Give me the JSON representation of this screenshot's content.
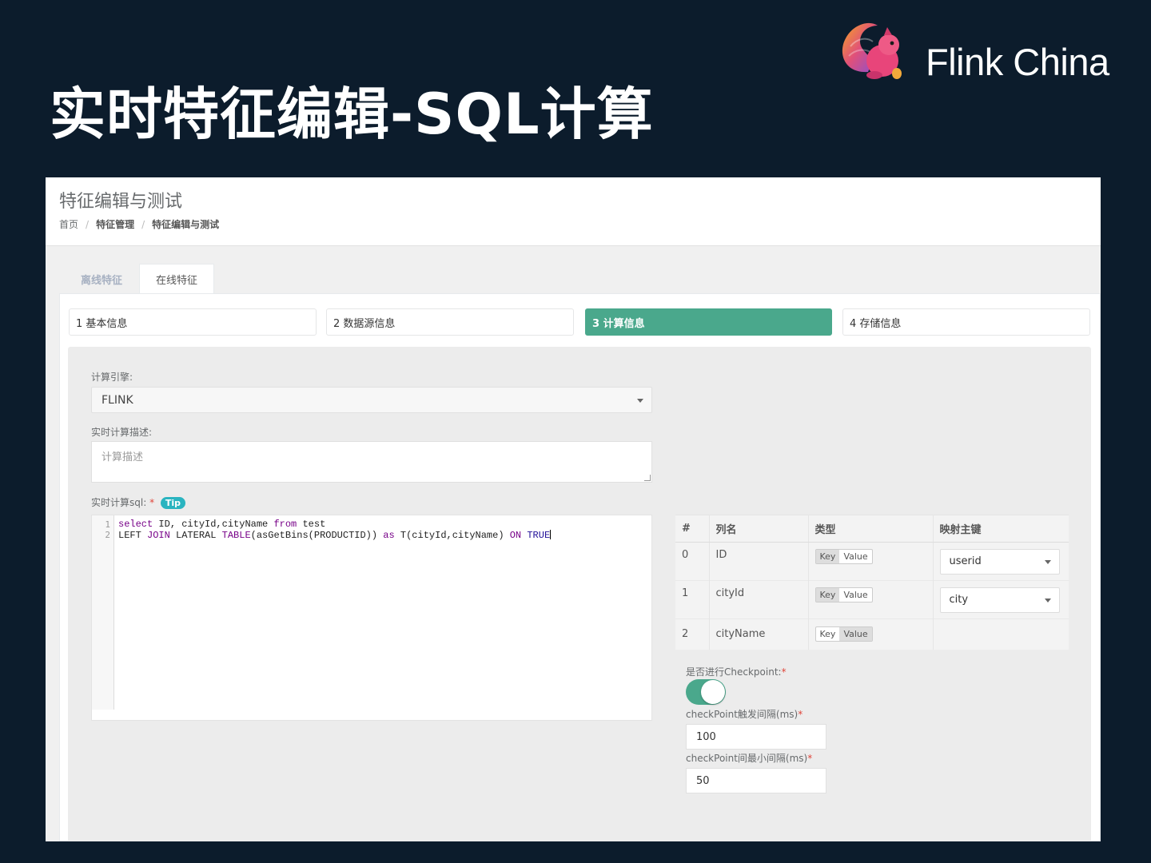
{
  "slide": {
    "title": "实时特征编辑-SQL计算",
    "logo_text": "Flink China"
  },
  "page": {
    "title": "特征编辑与测试",
    "breadcrumb": [
      "首页",
      "特征管理",
      "特征编辑与测试"
    ]
  },
  "tabs": [
    {
      "label": "离线特征",
      "active": false
    },
    {
      "label": "在线特征",
      "active": true
    }
  ],
  "steps": [
    {
      "label": "1 基本信息"
    },
    {
      "label": "2 数据源信息"
    },
    {
      "label": "3 计算信息",
      "active": true
    },
    {
      "label": "4 存储信息"
    }
  ],
  "form": {
    "engine_label": "计算引擎:",
    "engine_value": "FLINK",
    "desc_label": "实时计算描述:",
    "desc_placeholder": "计算描述",
    "sql_label": "实时计算sql:",
    "sql_required": "*",
    "tip_label": "Tip",
    "sql_line_numbers": [
      "1",
      "2"
    ]
  },
  "key_table": {
    "headers": [
      "#",
      "列名",
      "类型",
      "映射主键"
    ],
    "key_label": "Key",
    "value_label": "Value",
    "rows": [
      {
        "index": "0",
        "name": "ID",
        "type": "Key",
        "mapping": "userid"
      },
      {
        "index": "1",
        "name": "cityId",
        "type": "Key",
        "mapping": "city"
      },
      {
        "index": "2",
        "name": "cityName",
        "type": "Value",
        "mapping": ""
      }
    ]
  },
  "checkpoint": {
    "enable_label": "是否进行Checkpoint:",
    "enabled": true,
    "interval_label": "checkPoint触发间隔(ms)",
    "interval_value": "100",
    "min_pause_label": "checkPoint间最小间隔(ms)",
    "min_pause_value": "50",
    "required_mark": "*"
  },
  "colors": {
    "slide_bg": "#0c1c2c",
    "accent": "#4aa88c",
    "tip": "#2ab4c0"
  }
}
